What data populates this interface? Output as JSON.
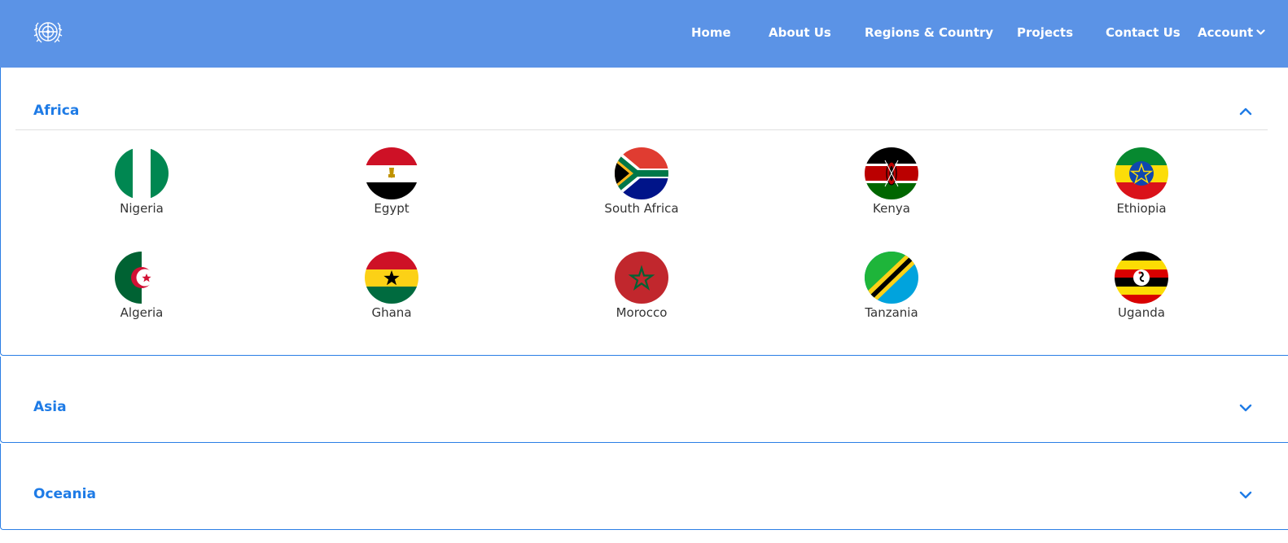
{
  "nav": {
    "logo_icon": "un-emblem-icon",
    "items": [
      {
        "label": "Home"
      },
      {
        "label": "About Us"
      },
      {
        "label": "Regions & Country"
      },
      {
        "label": "Projects"
      },
      {
        "label": "Contact Us"
      }
    ],
    "account_label": "Account"
  },
  "colors": {
    "navbar": "#5b93e6",
    "accent": "#1e7be6",
    "divider": "#e0e0e0"
  },
  "regions": [
    {
      "name": "Africa",
      "expanded": true,
      "countries": [
        {
          "name": "Nigeria",
          "flag_icon": "nigeria-flag-icon"
        },
        {
          "name": "Egypt",
          "flag_icon": "egypt-flag-icon"
        },
        {
          "name": "South Africa",
          "flag_icon": "south-africa-flag-icon"
        },
        {
          "name": "Kenya",
          "flag_icon": "kenya-flag-icon"
        },
        {
          "name": "Ethiopia",
          "flag_icon": "ethiopia-flag-icon"
        },
        {
          "name": "Algeria",
          "flag_icon": "algeria-flag-icon"
        },
        {
          "name": "Ghana",
          "flag_icon": "ghana-flag-icon"
        },
        {
          "name": "Morocco",
          "flag_icon": "morocco-flag-icon"
        },
        {
          "name": "Tanzania",
          "flag_icon": "tanzania-flag-icon"
        },
        {
          "name": "Uganda",
          "flag_icon": "uganda-flag-icon"
        }
      ]
    },
    {
      "name": "Asia",
      "expanded": false
    },
    {
      "name": "Oceania",
      "expanded": false
    }
  ]
}
